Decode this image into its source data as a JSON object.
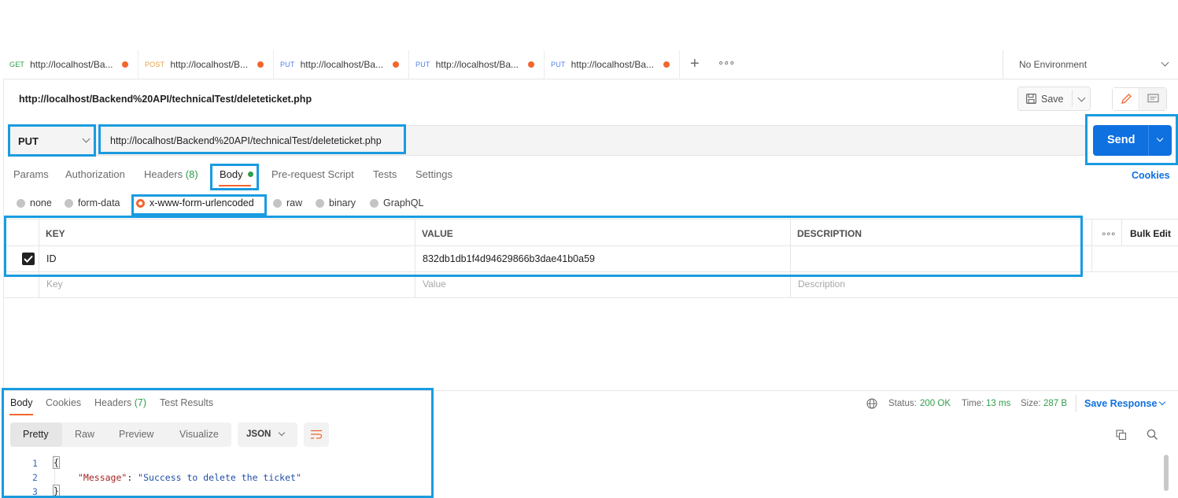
{
  "tabs": [
    {
      "method": "GET",
      "url": "http://localhost/Ba..."
    },
    {
      "method": "POST",
      "url": "http://localhost/B..."
    },
    {
      "method": "PUT",
      "url": "http://localhost/Ba..."
    },
    {
      "method": "PUT",
      "url": "http://localhost/Ba..."
    },
    {
      "method": "PUT",
      "url": "http://localhost/Ba..."
    }
  ],
  "environment": "No Environment",
  "request_title": "http://localhost/Backend%20API/technicalTest/deleteticket.php",
  "save_label": "Save",
  "method": "PUT",
  "url": "http://localhost/Backend%20API/technicalTest/deleteticket.php",
  "send_label": "Send",
  "request_tabs": {
    "params": "Params",
    "authorization": "Authorization",
    "headers": "Headers",
    "headers_count": "(8)",
    "body": "Body",
    "pre_request": "Pre-request Script",
    "tests": "Tests",
    "settings": "Settings",
    "cookies": "Cookies"
  },
  "body_types": [
    "none",
    "form-data",
    "x-www-form-urlencoded",
    "raw",
    "binary",
    "GraphQL"
  ],
  "table": {
    "headers": {
      "key": "KEY",
      "value": "VALUE",
      "description": "DESCRIPTION"
    },
    "bulk_edit": "Bulk Edit",
    "rows": [
      {
        "key": "ID",
        "value": "832db1db1f4d94629866b3dae41b0a59",
        "description": ""
      }
    ],
    "placeholders": {
      "key": "Key",
      "value": "Value",
      "description": "Description"
    }
  },
  "response": {
    "tabs": {
      "body": "Body",
      "cookies": "Cookies",
      "headers": "Headers",
      "headers_count": "(7)",
      "test_results": "Test Results"
    },
    "status_label": "Status:",
    "status": "200 OK",
    "time_label": "Time:",
    "time": "13 ms",
    "size_label": "Size:",
    "size": "287 B",
    "save_response": "Save Response",
    "formats": [
      "Pretty",
      "Raw",
      "Preview",
      "Visualize"
    ],
    "language": "JSON",
    "lines": [
      {
        "num": "1",
        "text": "{"
      },
      {
        "num": "2",
        "key": "\"Message\"",
        "colon": ": ",
        "value": "\"Success to delete the ticket\""
      },
      {
        "num": "3",
        "text": "}"
      }
    ]
  },
  "colors": {
    "accent": "#f2662f",
    "send": "#0f70e0",
    "highlight": "#1a9be0",
    "status_ok": "#2f9e49"
  }
}
